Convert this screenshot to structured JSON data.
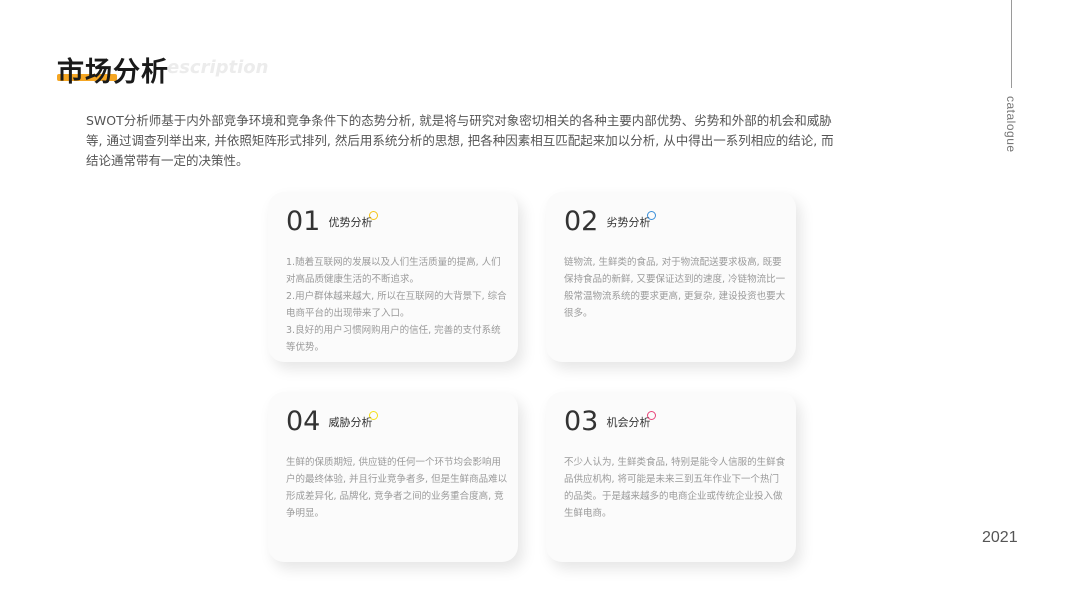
{
  "header": {
    "title": "市场分析",
    "ghost": "escription",
    "side_label": "catalogue",
    "year": "2021"
  },
  "intro": "SWOT分析师基于内外部竞争环境和竞争条件下的态势分析, 就是将与研究对象密切相关的各种主要内部优势、劣势和外部的机会和威胁等, 通过调查列举出来, 并依照矩阵形式排列, 然后用系统分析的思想, 把各种因素相互匹配起来加以分析, 从中得出一系列相应的结论, 而结论通常带有一定的决策性。",
  "cards": [
    {
      "num": "01",
      "label": "优势分析",
      "dot_color": "#f5c518",
      "body": "1.随着互联网的发展以及人们生活质量的提高, 人们对高品质健康生活的不断追求。\n2.用户群体越来越大, 所以在互联网的大背景下, 综合电商平台的出现带来了入口。\n3.良好的用户习惯网购用户的信任, 完善的支付系统等优势。"
    },
    {
      "num": "02",
      "label": "劣势分析",
      "dot_color": "#3a8fd9",
      "body": "链物流, 生鲜类的食品, 对于物流配送要求极高, 既要保持食品的新鲜, 又要保证达到的速度, 冷链物流比一般常温物流系统的要求更高, 更复杂, 建设投资也要大很多。"
    },
    {
      "num": "04",
      "label": "威胁分析",
      "dot_color": "#f5e018",
      "body": "生鲜的保质期短, 供应链的任何一个环节均会影响用户的最终体验, 并且行业竞争者多, 但是生鲜商品难以形成差异化, 品牌化, 竞争者之间的业务重合度高, 竞争明显。"
    },
    {
      "num": "03",
      "label": "机会分析",
      "dot_color": "#e8457a",
      "body": "不少人认为, 生鲜类食品, 特别是能令人信服的生鲜食品供应机构, 将可能是未来三到五年作业下一个热门的品类。于是越来越多的电商企业或传统企业投入做生鲜电商。"
    }
  ]
}
